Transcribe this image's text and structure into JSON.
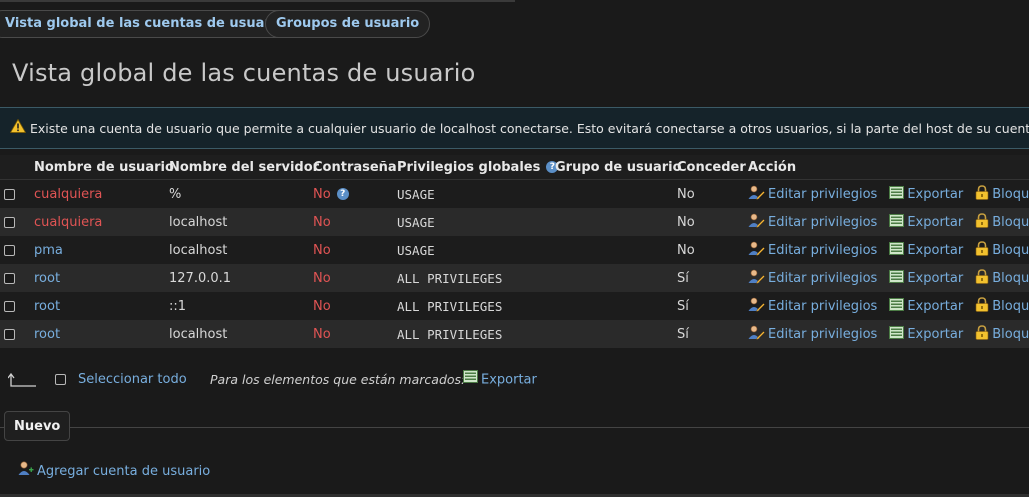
{
  "tabs": {
    "overview": "Vista global de las cuentas de usuario",
    "groups": "Groupos de usuario"
  },
  "page_title": "Vista global de las cuentas de usuario",
  "warning": "Existe una cuenta de usuario que permite a cualquier usuario de localhost conectarse. Esto evitará conectarse a otros usuarios, si la parte del host de su cuenta pe",
  "table": {
    "headers": {
      "username": "Nombre de usuario",
      "host": "Nombre del servidor",
      "password": "Contraseña",
      "privileges": "Privilegios globales",
      "group": "Grupo de usuario",
      "grant": "Conceder",
      "action": "Acción"
    },
    "rows": [
      {
        "user": "cualquiera",
        "host": "%",
        "password": "No",
        "privileges": "USAGE",
        "group": "",
        "grant": "No"
      },
      {
        "user": "cualquiera",
        "host": "localhost",
        "password": "No",
        "privileges": "USAGE",
        "group": "",
        "grant": "No"
      },
      {
        "user": "pma",
        "host": "localhost",
        "password": "No",
        "privileges": "USAGE",
        "group": "",
        "grant": "No"
      },
      {
        "user": "root",
        "host": "127.0.0.1",
        "password": "No",
        "privileges": "ALL PRIVILEGES",
        "group": "",
        "grant": "Sí"
      },
      {
        "user": "root",
        "host": "::1",
        "password": "No",
        "privileges": "ALL PRIVILEGES",
        "group": "",
        "grant": "Sí"
      },
      {
        "user": "root",
        "host": "localhost",
        "password": "No",
        "privileges": "ALL PRIVILEGES",
        "group": "",
        "grant": "Sí"
      }
    ],
    "actions": {
      "edit": "Editar privilegios",
      "export": "Exportar",
      "lock": "Bloque"
    }
  },
  "footer": {
    "select_all": "Seleccionar todo",
    "marked_label": "Para los elementos que están marcados:",
    "export": "Exportar"
  },
  "new_section": {
    "legend": "Nuevo",
    "add_user": "Agregar cuenta de usuario"
  },
  "colors": {
    "link": "#78aede",
    "danger": "#e05454",
    "warning_bg": "#15232a"
  },
  "icons": [
    "warning-icon",
    "help-icon",
    "edit-privileges-icon",
    "export-icon",
    "lock-icon",
    "arrow-icon",
    "add-user-icon"
  ]
}
